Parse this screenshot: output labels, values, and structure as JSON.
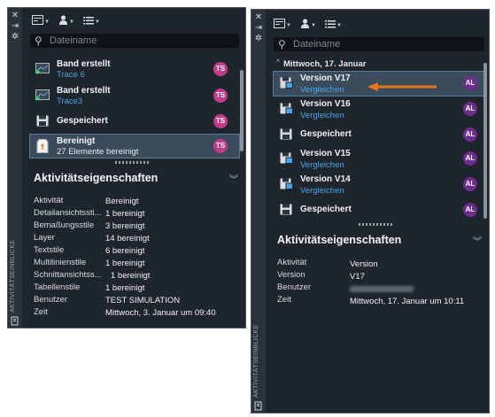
{
  "colors": {
    "panel_bg": "#1f252d",
    "accent_link": "#49a5e8",
    "avatar_ts": "#c23b88",
    "avatar_al": "#6d2c8e",
    "arrow": "#e8731e",
    "selection": "#3a4b5b"
  },
  "left": {
    "rail": {
      "close": "✕",
      "pin": "⇥",
      "settings": "✲",
      "vertical_label": "AKTIVITÄTSEINBLICKE"
    },
    "toolbar": {
      "filter_icon": "filter-icon",
      "user_icon": "user-icon",
      "list_icon": "list-icon"
    },
    "search": {
      "placeholder": "Dateiname"
    },
    "items": [
      {
        "title": "Band erstellt",
        "sub": "Trace 6",
        "icon": "drawing-icon",
        "avatar": "TS"
      },
      {
        "title": "Band erstellt",
        "sub": "Trace3",
        "icon": "drawing-icon",
        "avatar": "TS"
      },
      {
        "title": "Gespeichert",
        "sub": "",
        "icon": "save-icon",
        "avatar": "TS"
      },
      {
        "title": "Bereinigt",
        "sub": "27 Elemente bereinigt",
        "icon": "purge-icon",
        "avatar": "TS"
      }
    ],
    "props": {
      "title": "Aktivitätseigenschaften",
      "rows": [
        {
          "label": "Aktivität",
          "value": "Bereinigt"
        },
        {
          "label": "Detailansichtssti...",
          "value": "1 bereinigt"
        },
        {
          "label": "Bemaßungsstile",
          "value": "3 bereinigt"
        },
        {
          "label": "Layer",
          "value": "14 bereinigt"
        },
        {
          "label": "Textstile",
          "value": "6 bereinigt"
        },
        {
          "label": "Multilinienstile",
          "value": "1 bereinigt"
        },
        {
          "label": "Schnittansichtss...",
          "value": "1 bereinigt"
        },
        {
          "label": "Tabellenstile",
          "value": "1 bereinigt"
        },
        {
          "label": "Benutzer",
          "value": "TEST SIMULATION"
        },
        {
          "label": "Zeit",
          "value": "Mittwoch, 3. Januar um 09:40"
        }
      ]
    }
  },
  "right": {
    "rail": {
      "close": "✕",
      "pin": "⇥",
      "settings": "✲",
      "vertical_label": "AKTIVITÄTSEINBLICKE"
    },
    "search": {
      "placeholder": "Dateiname"
    },
    "date_header": "Mittwoch, 17. Januar",
    "items": [
      {
        "title": "Version V17",
        "sub": "Vergleichen",
        "icon": "version-icon",
        "avatar": "AL"
      },
      {
        "title": "Version V16",
        "sub": "Vergleichen",
        "icon": "version-icon",
        "avatar": "AL"
      },
      {
        "title": "Gespeichert",
        "sub": "",
        "icon": "save-icon",
        "avatar": "AL"
      },
      {
        "title": "Version V15",
        "sub": "Vergleichen",
        "icon": "version-icon",
        "avatar": "AL"
      },
      {
        "title": "Version V14",
        "sub": "Vergleichen",
        "icon": "version-icon",
        "avatar": "AL"
      },
      {
        "title": "Gespeichert",
        "sub": "",
        "icon": "save-icon",
        "avatar": "AL"
      }
    ],
    "props": {
      "title": "Aktivitätseigenschaften",
      "rows": [
        {
          "label": "Aktivität",
          "value": "Version"
        },
        {
          "label": "Version",
          "value": "V17"
        },
        {
          "label": "Benutzer",
          "value": ""
        },
        {
          "label": "Zeit",
          "value": "Mittwoch, 17. Januar um 10:11"
        }
      ]
    }
  }
}
